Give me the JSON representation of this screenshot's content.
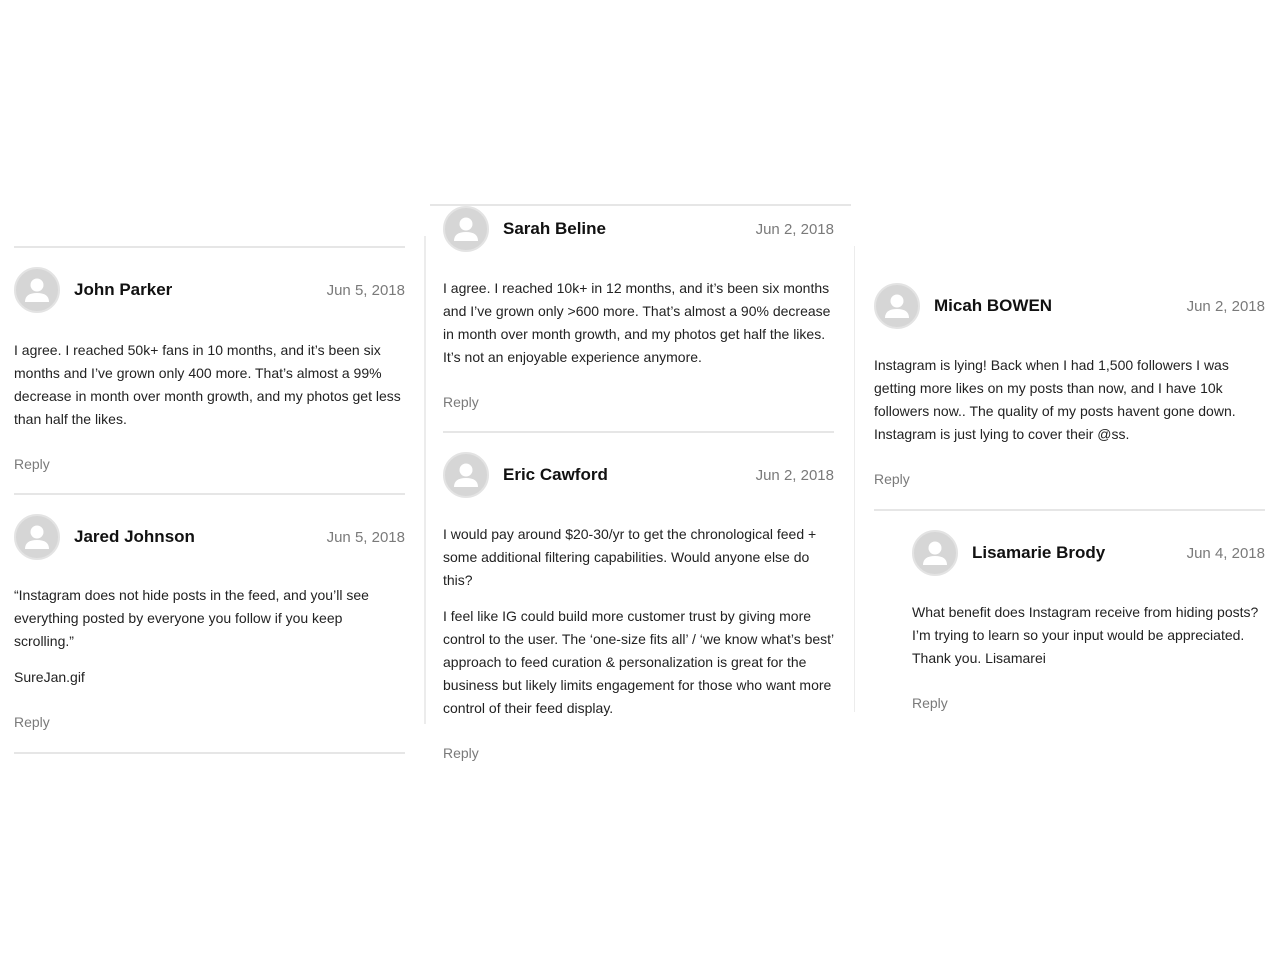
{
  "columns": {
    "left": {
      "comments": [
        {
          "author": "John Parker",
          "date": "Jun 5, 2018",
          "paragraphs": [
            "I agree. I reached 50k+ fans in 10 months, and it’s been six months and I’ve grown only 400 more. That’s almost a 99% decrease in month over month growth, and my photos get less than half the likes."
          ],
          "reply_label": "Reply"
        },
        {
          "author": "Jared Johnson",
          "date": "Jun 5, 2018",
          "paragraphs": [
            "“Instagram does not hide posts in the feed, and you’ll see everything posted by everyone you follow if you keep scrolling.”",
            "SureJan.gif"
          ],
          "reply_label": "Reply"
        }
      ]
    },
    "middle": {
      "comments": [
        {
          "author": "Sarah Beline",
          "date": "Jun 2, 2018",
          "paragraphs": [
            "I agree. I reached 10k+ in 12 months, and it’s been six months and I’ve grown only >600 more. That’s almost a 90% decrease in month over month growth, and my photos get half the likes. It’s not an enjoyable experience anymore."
          ],
          "reply_label": "Reply"
        },
        {
          "author": "Eric Cawford",
          "date": "Jun 2, 2018",
          "paragraphs": [
            "I would pay around $20-30/yr to get the chronological feed + some additional filtering capabilities. Would anyone else do this?",
            "I feel like IG could build more customer trust by giving more control to the user. The ‘one-size fits all’ / ‘we know what’s best’ approach to feed curation & personalization is great for the business but likely limits engagement for those who want more control of their feed display."
          ],
          "reply_label": "Reply"
        }
      ]
    },
    "right": {
      "comments": [
        {
          "author": "Micah BOWEN",
          "date": "Jun 2, 2018",
          "paragraphs": [
            "Instagram is lying! Back when I had 1,500 followers I was getting more likes on my posts than now, and I have 10k followers now.. The quality of my posts havent gone down. Instagram is just lying to cover their @ss."
          ],
          "reply_label": "Reply"
        },
        {
          "author": "Lisamarie Brody",
          "date": "Jun 4, 2018",
          "paragraphs": [
            "What benefit does Instagram receive from hiding posts? I’m trying to learn so your input would be appreciated. Thank you. Lisamarei"
          ],
          "reply_label": "Reply"
        }
      ]
    }
  },
  "icons": {
    "avatar": "default-user-avatar-icon"
  },
  "colors": {
    "avatar_bg": "#d6d6d6",
    "divider": "#e6e6e6",
    "meta_text": "#7a7a7a"
  }
}
